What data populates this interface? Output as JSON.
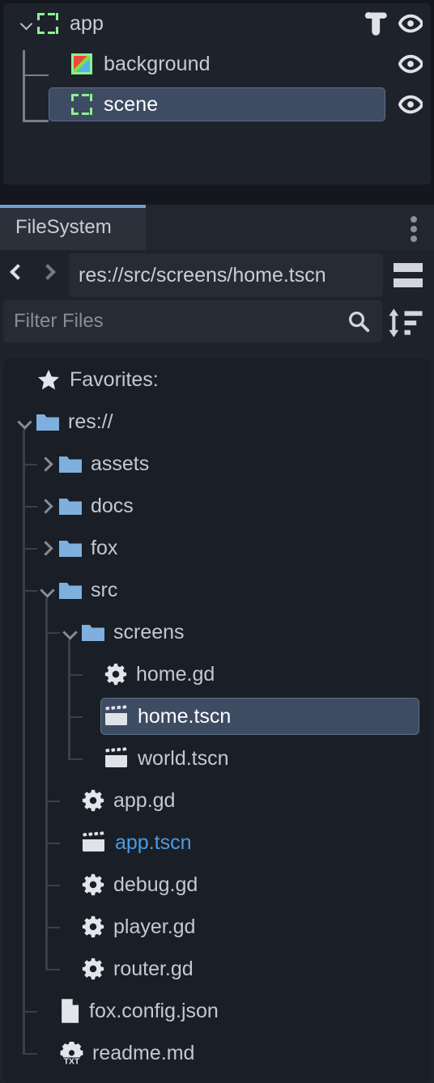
{
  "theme": {
    "window_bg": "#14171e",
    "panel_bg": "#1e222b",
    "tree_bg": "#1a1e26",
    "selection_bg": "#3d4c63",
    "selection_border": "#5d6e85",
    "tab_accent": "#6d9fd0",
    "folder_color": "#7fb0dd",
    "accent_text": "#4d9ae0",
    "text_color": "#c3c8d1",
    "node_icon_green": "#8ef08e"
  },
  "scene_tree": {
    "nodes": [
      {
        "label": "app",
        "icon": "control-node-icon",
        "depth": 0,
        "expanded": true,
        "has_caret": true,
        "selected": false,
        "has_script": true,
        "script_icon": "script-icon",
        "visibility_icon": "eye-icon"
      },
      {
        "label": "background",
        "icon": "colorrect-node-icon",
        "depth": 1,
        "expanded": false,
        "has_caret": false,
        "selected": false,
        "has_script": false,
        "visibility_icon": "eye-icon"
      },
      {
        "label": "scene",
        "icon": "control-node-icon",
        "depth": 1,
        "expanded": false,
        "has_caret": false,
        "selected": true,
        "has_script": false,
        "visibility_icon": "eye-icon"
      }
    ]
  },
  "filesystem": {
    "tab": {
      "label": "FileSystem",
      "active": true
    },
    "menu_icon": "kebab-menu-icon",
    "nav": {
      "back_icon": "chevron-left-icon",
      "back_enabled": true,
      "forward_icon": "chevron-right-icon",
      "forward_enabled": false
    },
    "path": "res://src/screens/home.tscn",
    "split_toggle_icon": "split-mode-icon",
    "filter": {
      "placeholder": "Filter Files",
      "value": "",
      "search_icon": "search-icon"
    },
    "sort_icon": "sort-icon",
    "tree": [
      {
        "label": "Favorites:",
        "icon": "star-icon",
        "depth": 0,
        "caret": "none",
        "selected": false,
        "accent": false
      },
      {
        "label": "res://",
        "icon": "folder-icon",
        "depth": 0,
        "caret": "expanded",
        "selected": false,
        "accent": false
      },
      {
        "label": "assets",
        "icon": "folder-icon",
        "depth": 1,
        "caret": "collapsed",
        "selected": false,
        "accent": false
      },
      {
        "label": "docs",
        "icon": "folder-icon",
        "depth": 1,
        "caret": "collapsed",
        "selected": false,
        "accent": false
      },
      {
        "label": "fox",
        "icon": "folder-icon",
        "depth": 1,
        "caret": "collapsed",
        "selected": false,
        "accent": false
      },
      {
        "label": "src",
        "icon": "folder-icon",
        "depth": 1,
        "caret": "expanded",
        "selected": false,
        "accent": false
      },
      {
        "label": "screens",
        "icon": "folder-icon",
        "depth": 2,
        "caret": "expanded",
        "selected": false,
        "accent": false
      },
      {
        "label": "home.gd",
        "icon": "gdscript-icon",
        "depth": 3,
        "caret": "none",
        "selected": false,
        "accent": false
      },
      {
        "label": "home.tscn",
        "icon": "scene-icon",
        "depth": 3,
        "caret": "none",
        "selected": true,
        "accent": false
      },
      {
        "label": "world.tscn",
        "icon": "scene-icon",
        "depth": 3,
        "caret": "none",
        "selected": false,
        "accent": false
      },
      {
        "label": "app.gd",
        "icon": "gdscript-icon",
        "depth": 2,
        "caret": "none",
        "selected": false,
        "accent": false
      },
      {
        "label": "app.tscn",
        "icon": "scene-icon",
        "depth": 2,
        "caret": "none",
        "selected": false,
        "accent": true
      },
      {
        "label": "debug.gd",
        "icon": "gdscript-icon",
        "depth": 2,
        "caret": "none",
        "selected": false,
        "accent": false
      },
      {
        "label": "player.gd",
        "icon": "gdscript-icon",
        "depth": 2,
        "caret": "none",
        "selected": false,
        "accent": false
      },
      {
        "label": "router.gd",
        "icon": "gdscript-icon",
        "depth": 2,
        "caret": "none",
        "selected": false,
        "accent": false
      },
      {
        "label": "fox.config.json",
        "icon": "file-icon",
        "depth": 1,
        "caret": "none",
        "selected": false,
        "accent": false
      },
      {
        "label": "readme.md",
        "icon": "textfile-icon",
        "depth": 1,
        "caret": "none",
        "selected": false,
        "accent": false
      }
    ]
  }
}
